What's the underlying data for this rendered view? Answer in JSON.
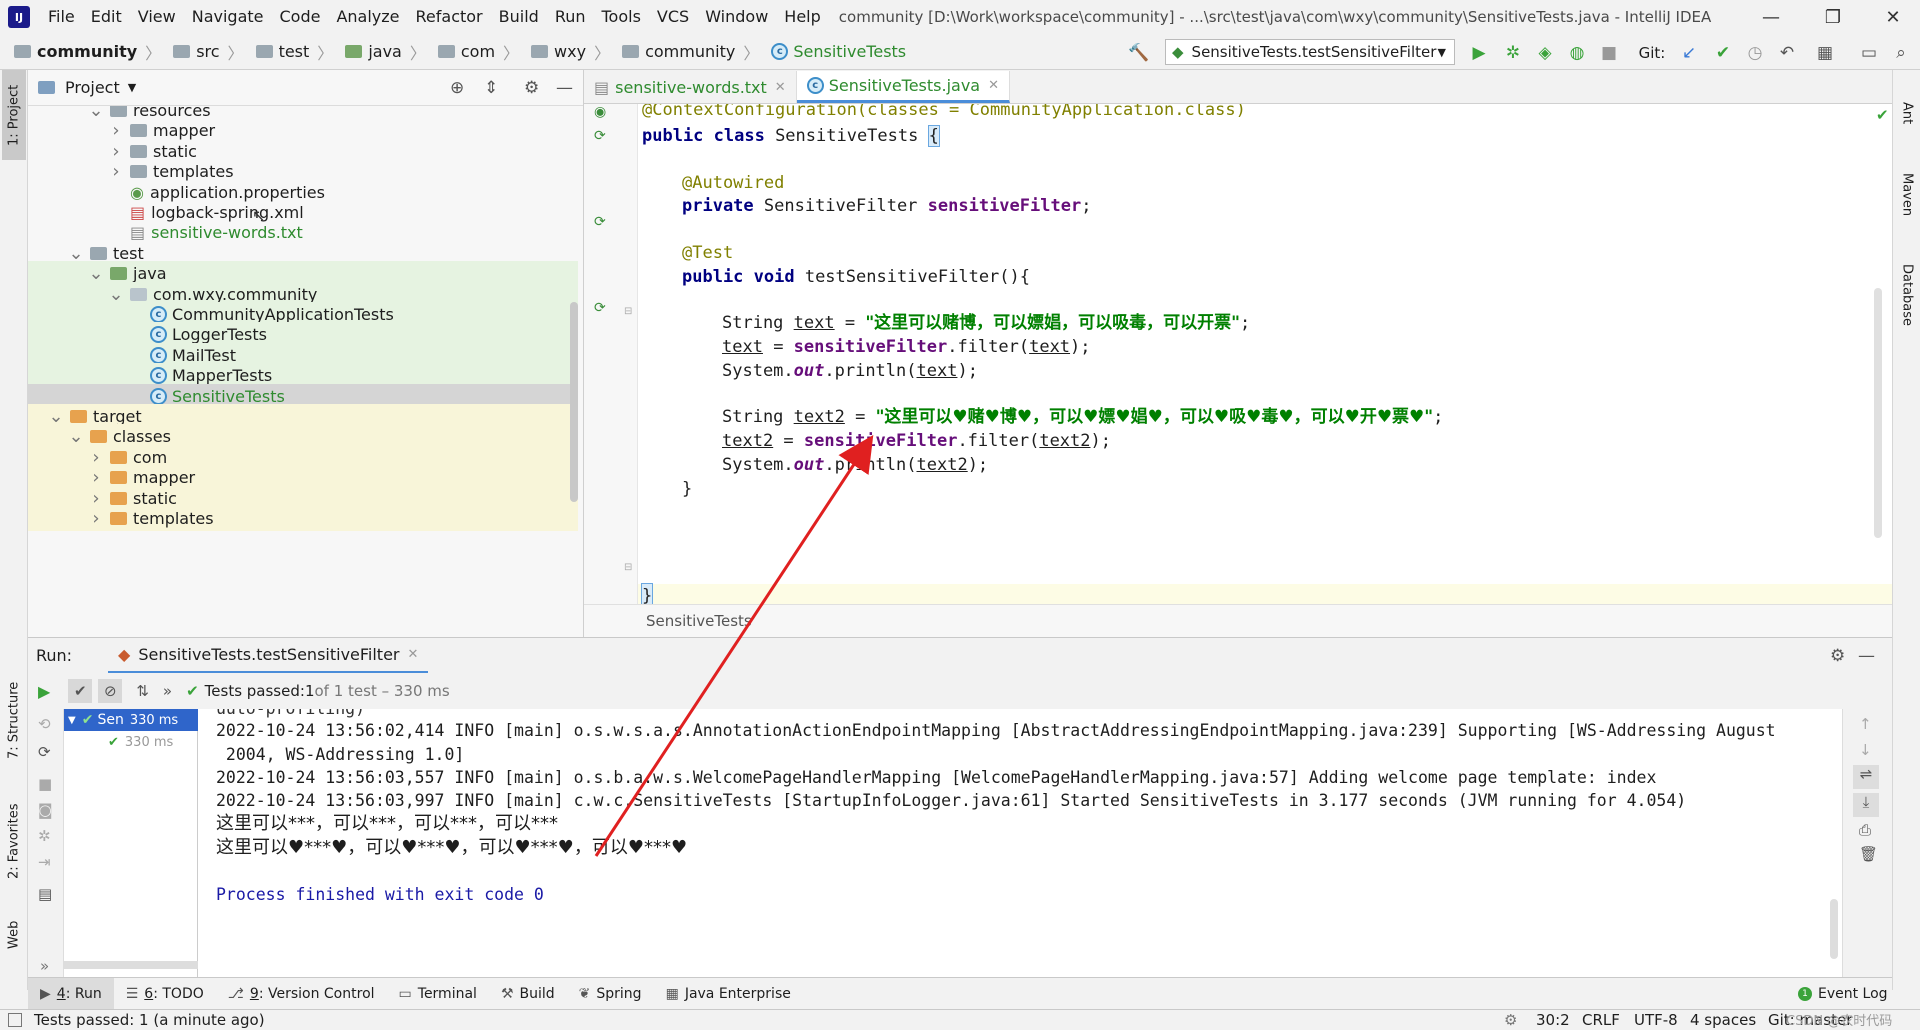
{
  "menubar": {
    "items": [
      "File",
      "Edit",
      "View",
      "Navigate",
      "Code",
      "Analyze",
      "Refactor",
      "Build",
      "Run",
      "Tools",
      "VCS",
      "Window",
      "Help"
    ],
    "title": "community [D:\\Work\\workspace\\community] - ...\\src\\test\\java\\com\\wxy\\community\\SensitiveTests.java - IntelliJ IDEA"
  },
  "breadcrumbs": [
    "community",
    "src",
    "test",
    "java",
    "com",
    "wxy",
    "community",
    "SensitiveTests"
  ],
  "toolbar": {
    "run_config": "SensitiveTests.testSensitiveFilter",
    "git_label": "Git:"
  },
  "left_tabs": {
    "project": "1: Project",
    "structure": "7: Structure",
    "favorites": "2: Favorites",
    "web": "Web"
  },
  "right_tabs": {
    "ant": "Ant",
    "maven": "Maven",
    "database": "Database"
  },
  "project": {
    "title": "Project",
    "tree": [
      {
        "label": "resources",
        "indent": 3,
        "arrow": "v",
        "icon": "folder",
        "style": ""
      },
      {
        "label": "mapper",
        "indent": 4,
        "arrow": ">",
        "icon": "folder",
        "style": ""
      },
      {
        "label": "static",
        "indent": 4,
        "arrow": ">",
        "icon": "folder",
        "style": ""
      },
      {
        "label": "templates",
        "indent": 4,
        "arrow": ">",
        "icon": "folder",
        "style": ""
      },
      {
        "label": "application.properties",
        "indent": 4,
        "arrow": "",
        "icon": "props",
        "style": ""
      },
      {
        "label": "logback-spring.xml",
        "indent": 4,
        "arrow": "",
        "icon": "xml",
        "style": ""
      },
      {
        "label": "sensitive-words.txt",
        "indent": 4,
        "arrow": "",
        "icon": "txt",
        "style": "green-text"
      },
      {
        "label": "test",
        "indent": 2,
        "arrow": "v",
        "icon": "folder",
        "style": ""
      },
      {
        "label": "java",
        "indent": 3,
        "arrow": "v",
        "icon": "folder-green",
        "style": "green"
      },
      {
        "label": "com.wxy.community",
        "indent": 4,
        "arrow": "v",
        "icon": "package",
        "style": "green"
      },
      {
        "label": "CommunityApplicationTests",
        "indent": 5,
        "arrow": "",
        "icon": "class",
        "style": "green"
      },
      {
        "label": "LoggerTests",
        "indent": 5,
        "arrow": "",
        "icon": "class",
        "style": "green"
      },
      {
        "label": "MailTest",
        "indent": 5,
        "arrow": "",
        "icon": "class",
        "style": "green"
      },
      {
        "label": "MapperTests",
        "indent": 5,
        "arrow": "",
        "icon": "class",
        "style": "green"
      },
      {
        "label": "SensitiveTests",
        "indent": 5,
        "arrow": "",
        "icon": "class",
        "style": "selected"
      },
      {
        "label": "target",
        "indent": 1,
        "arrow": "v",
        "icon": "folder-orange",
        "style": "yellow"
      },
      {
        "label": "classes",
        "indent": 2,
        "arrow": "v",
        "icon": "folder-orange",
        "style": "yellow"
      },
      {
        "label": "com",
        "indent": 3,
        "arrow": ">",
        "icon": "folder-orange",
        "style": "yellow"
      },
      {
        "label": "mapper",
        "indent": 3,
        "arrow": ">",
        "icon": "folder-orange",
        "style": "yellow"
      },
      {
        "label": "static",
        "indent": 3,
        "arrow": ">",
        "icon": "folder-orange",
        "style": "yellow"
      },
      {
        "label": "templates",
        "indent": 3,
        "arrow": ">",
        "icon": "folder-orange",
        "style": "yellow"
      }
    ]
  },
  "editor": {
    "tabs": [
      {
        "label": "sensitive-words.txt",
        "active": false
      },
      {
        "label": "SensitiveTests.java",
        "active": true
      }
    ],
    "breadcrumb": "SensitiveTests",
    "code": {
      "line1": "@ContextConfiguration(classes = CommunityApplication.class)",
      "line2_kw": "public class ",
      "line2_name": "SensitiveTests ",
      "line2_brace": "{",
      "autowired": "@Autowired",
      "field_kw": "private ",
      "field_type": "SensitiveFilter ",
      "field_name": "sensitiveFilter",
      "field_end": ";",
      "test_ann": "@Test",
      "method_kw": "public void ",
      "method_sig": "testSensitiveFilter(){",
      "s1_type": "String ",
      "s1_var": "text",
      "s1_eq": " = ",
      "s1_str": "\"这里可以赌博，可以嫖娼，可以吸毒，可以开票\"",
      "s1_end": ";",
      "s2_var": "text",
      "s2_eq": " = ",
      "s2_fld": "sensitiveFilter",
      "s2_call": ".filter(",
      "s2_arg": "text",
      "s2_end": ");",
      "s3_pre": "System.",
      "s3_out": "out",
      "s3_call": ".println(",
      "s3_arg": "text",
      "s3_end": ");",
      "s4_type": "String ",
      "s4_var": "text2",
      "s4_eq": " = ",
      "s4_str": "\"这里可以♥赌♥博♥，可以♥嫖♥娼♥，可以♥吸♥毒♥，可以♥开♥票♥\"",
      "s4_end": ";",
      "s5_var": "text2",
      "s5_eq": " = ",
      "s5_fld": "sensitiveFilter",
      "s5_call": ".filter(",
      "s5_arg": "text2",
      "s5_end": ");",
      "s6_pre": "System.",
      "s6_out": "out",
      "s6_call": ".println(",
      "s6_arg": "text2",
      "s6_end": ");",
      "close1": "}",
      "close2": "}"
    }
  },
  "run": {
    "label": "Run:",
    "tab": "SensitiveTests.testSensitiveFilter",
    "status_prefix": "Tests passed: ",
    "status_count": "1",
    "status_suffix": " of 1 test – 330 ms",
    "tree": [
      {
        "label": "Sen",
        "time": "330 ms"
      },
      {
        "label": "",
        "time": "330 ms"
      }
    ],
    "console": {
      "line0": "uuto-profiling)",
      "line1": "2022-10-24 13:56:02,414 INFO [main] o.s.w.s.a.s.AnnotationActionEndpointMapping [AbstractAddressingEndpointMapping.java:239] Supporting [WS-Addressing August",
      "line2": " 2004, WS-Addressing 1.0]",
      "line3": "2022-10-24 13:56:03,557 INFO [main] o.s.b.a.w.s.WelcomePageHandlerMapping [WelcomePageHandlerMapping.java:57] Adding welcome page template: index",
      "line4": "2022-10-24 13:56:03,997 INFO [main] c.w.c.SensitiveTests [StartupInfoLogger.java:61] Started SensitiveTests in 3.177 seconds (JVM running for 4.054)",
      "line5": "这里可以***，可以***，可以***，可以***",
      "line6": "这里可以♥***♥，可以♥***♥，可以♥***♥，可以♥***♥",
      "line7": "Process finished with exit code 0"
    }
  },
  "tool_tabs": [
    {
      "num": "4",
      "label": ": Run",
      "active": true
    },
    {
      "num": "6",
      "label": ": TODO",
      "active": false
    },
    {
      "num": "9",
      "label": ": Version Control",
      "active": false
    },
    {
      "num": "",
      "label": "Terminal",
      "active": false
    },
    {
      "num": "",
      "label": "Build",
      "active": false
    },
    {
      "num": "",
      "label": "Spring",
      "active": false
    },
    {
      "num": "",
      "label": "Java Enterprise",
      "active": false
    }
  ],
  "event_log": "Event Log",
  "status": {
    "left": "Tests passed: 1 (a minute ago)",
    "position": "30:2",
    "line_sep": "CRLF",
    "encoding": "UTF-8",
    "indent": "4 spaces",
    "git": "Git: master",
    "watermark": "CSDN @农时代码"
  },
  "colors": {
    "accent": "#4a8dd9",
    "green_bg": "#e6f3e1",
    "yellow_bg": "#f8f5d9",
    "annotation_arrow": "#e02020"
  }
}
